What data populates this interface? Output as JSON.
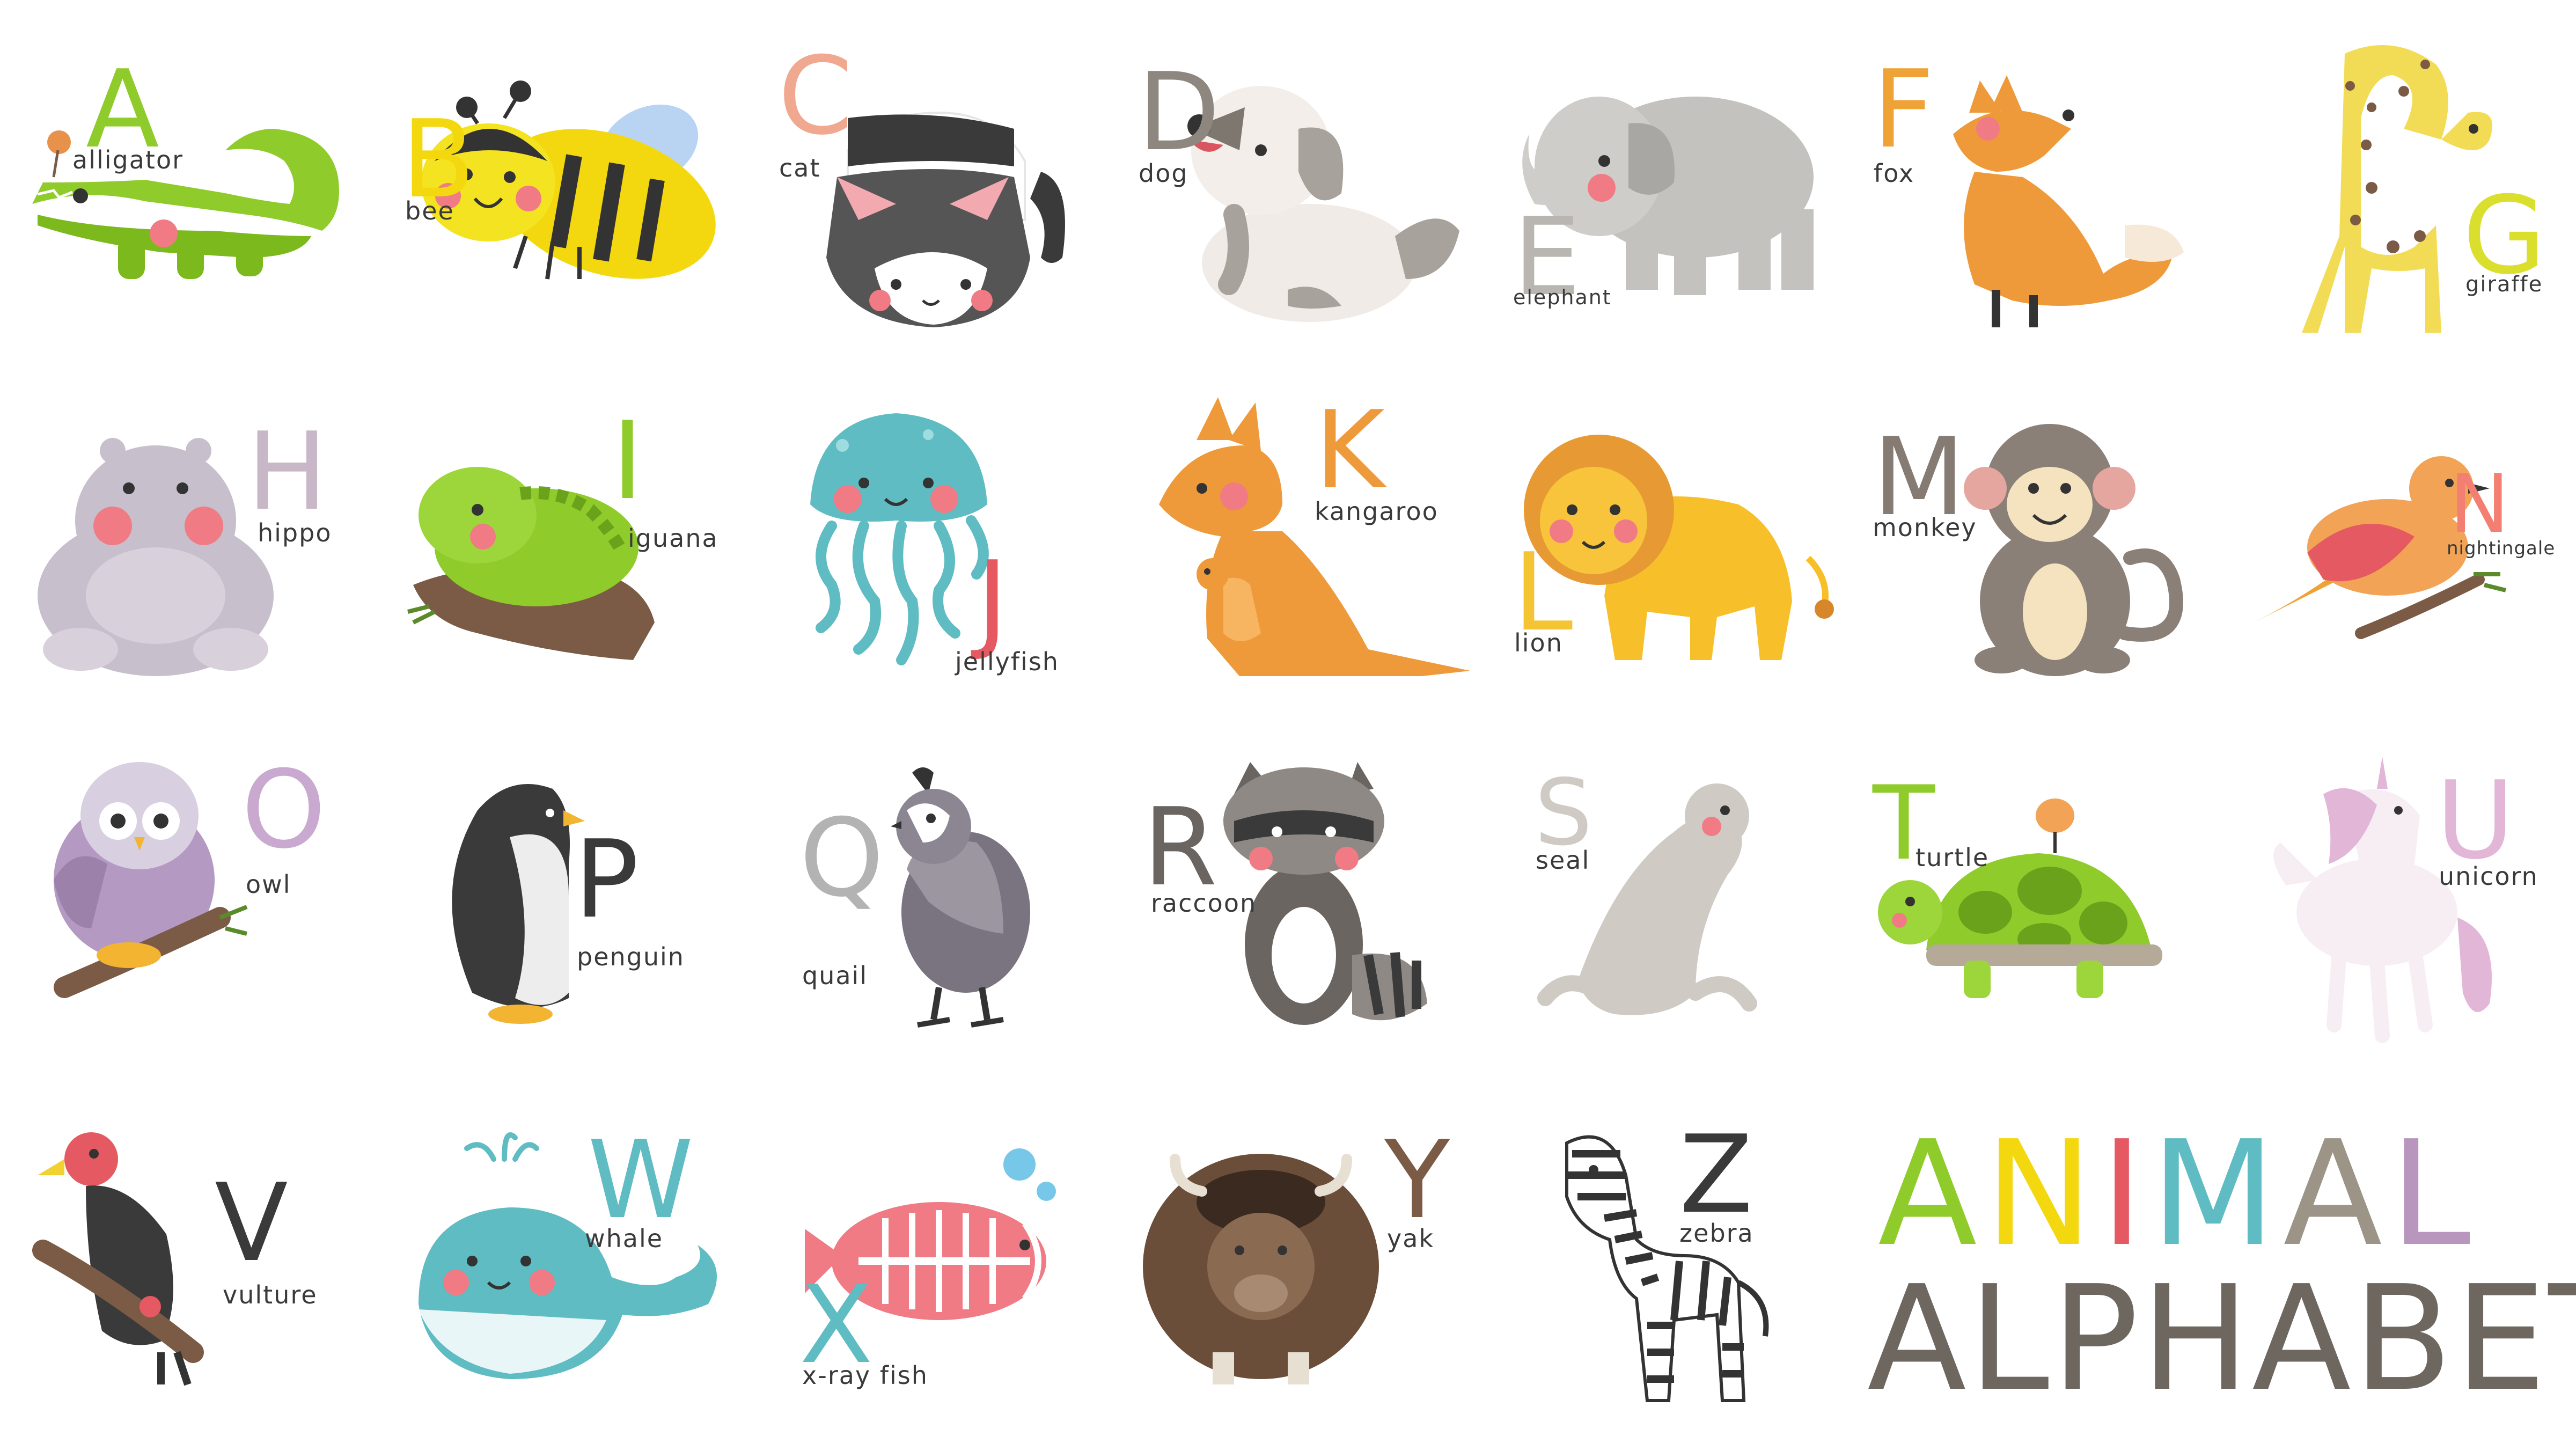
{
  "colors": {
    "green": "#8fcb2a",
    "yellow": "#f4d80f",
    "coral": "#f0a08a",
    "taupe": "#8b857c",
    "gray": "#b8b6b2",
    "orange": "#ef9a3a",
    "lilac": "#c9aec9",
    "red": "#e55a62",
    "teal": "#5ebcc2",
    "dark": "#3a3a3a",
    "title_gray": "#6e675f"
  },
  "animals": [
    {
      "letter": "A",
      "word": "alligator",
      "letter_color": "#8fcb2a"
    },
    {
      "letter": "B",
      "word": "bee",
      "letter_color": "#f4d80f"
    },
    {
      "letter": "C",
      "word": "cat",
      "letter_color": "#f0a890"
    },
    {
      "letter": "D",
      "word": "dog",
      "letter_color": "#8e877f"
    },
    {
      "letter": "E",
      "word": "elephant",
      "letter_color": "#b9b6b1"
    },
    {
      "letter": "F",
      "word": "fox",
      "letter_color": "#efa236"
    },
    {
      "letter": "G",
      "word": "giraffe",
      "letter_color": "#d9df2c"
    },
    {
      "letter": "H",
      "word": "hippo",
      "letter_color": "#c8b7c6"
    },
    {
      "letter": "I",
      "word": "iguana",
      "letter_color": "#8fcb2a"
    },
    {
      "letter": "J",
      "word": "jellyfish",
      "letter_color": "#e55a62"
    },
    {
      "letter": "K",
      "word": "kangaroo",
      "letter_color": "#ef9a3a"
    },
    {
      "letter": "L",
      "word": "lion",
      "letter_color": "#f4c435"
    },
    {
      "letter": "M",
      "word": "monkey",
      "letter_color": "#857b72"
    },
    {
      "letter": "N",
      "word": "nightingale",
      "letter_color": "#f27f72"
    },
    {
      "letter": "O",
      "word": "owl",
      "letter_color": "#c9a9cf"
    },
    {
      "letter": "P",
      "word": "penguin",
      "letter_color": "#3a3a3a"
    },
    {
      "letter": "Q",
      "word": "quail",
      "letter_color": "#b3b3b3"
    },
    {
      "letter": "R",
      "word": "raccoon",
      "letter_color": "#6a6560"
    },
    {
      "letter": "S",
      "word": "seal",
      "letter_color": "#cfcac4"
    },
    {
      "letter": "T",
      "word": "turtle",
      "letter_color": "#8fcb2a"
    },
    {
      "letter": "U",
      "word": "unicorn",
      "letter_color": "#e2b6d6"
    },
    {
      "letter": "V",
      "word": "vulture",
      "letter_color": "#3a3a3a"
    },
    {
      "letter": "W",
      "word": "whale",
      "letter_color": "#5ebcc2"
    },
    {
      "letter": "X",
      "word": "x-ray fish",
      "letter_color": "#5ebcc2"
    },
    {
      "letter": "Y",
      "word": "yak",
      "letter_color": "#7b5b45"
    },
    {
      "letter": "Z",
      "word": "zebra",
      "letter_color": "#3a3a3a"
    }
  ],
  "title": {
    "line1": [
      {
        "char": "A",
        "color": "#8fcb2a"
      },
      {
        "char": "N",
        "color": "#f4d80f"
      },
      {
        "char": "I",
        "color": "#e55a62"
      },
      {
        "char": "M",
        "color": "#5ebcc2"
      },
      {
        "char": "A",
        "color": "#9c9587"
      },
      {
        "char": "L",
        "color": "#b896be"
      }
    ],
    "line2": "ALPHABET"
  }
}
